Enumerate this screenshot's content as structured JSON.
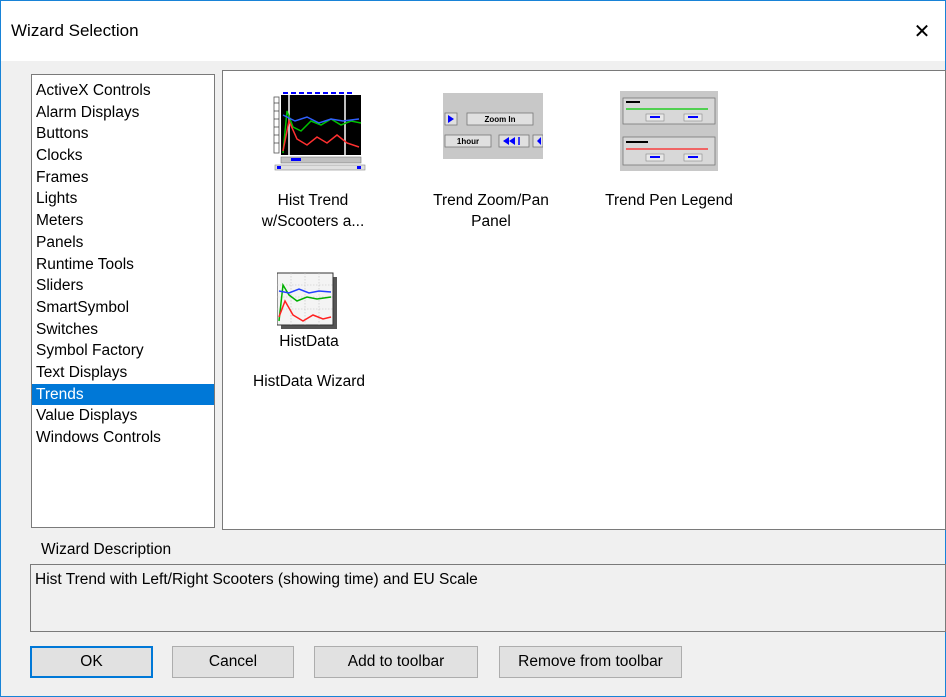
{
  "window": {
    "title": "Wizard Selection",
    "close_glyph": "✕",
    "accent": "#0078d7"
  },
  "categories": [
    {
      "label": "ActiveX Controls",
      "selected": false
    },
    {
      "label": "Alarm Displays",
      "selected": false
    },
    {
      "label": "Buttons",
      "selected": false
    },
    {
      "label": "Clocks",
      "selected": false
    },
    {
      "label": "Frames",
      "selected": false
    },
    {
      "label": "Lights",
      "selected": false
    },
    {
      "label": "Meters",
      "selected": false
    },
    {
      "label": "Panels",
      "selected": false
    },
    {
      "label": "Runtime Tools",
      "selected": false
    },
    {
      "label": "Sliders",
      "selected": false
    },
    {
      "label": "SmartSymbol",
      "selected": false
    },
    {
      "label": "Switches",
      "selected": false
    },
    {
      "label": "Symbol Factory",
      "selected": false
    },
    {
      "label": "Text Displays",
      "selected": false
    },
    {
      "label": "Trends",
      "selected": true
    },
    {
      "label": "Value Displays",
      "selected": false
    },
    {
      "label": "Windows Controls",
      "selected": false
    }
  ],
  "wizards": [
    {
      "caption_line1": "Hist Trend",
      "caption_line2": "w/Scooters a...",
      "icon": "hist-trend-icon"
    },
    {
      "caption_line1": "Trend Zoom/Pan",
      "caption_line2": "Panel",
      "icon": "trend-zoom-pan-icon",
      "icon_text": {
        "zoom_in": "Zoom In",
        "hour": "1hour"
      }
    },
    {
      "caption_line1": "Trend Pen Legend",
      "caption_line2": "",
      "icon": "trend-pen-legend-icon"
    },
    {
      "caption_line1": "HistData",
      "caption_line2": "HistData Wizard",
      "icon": "histdata-icon"
    }
  ],
  "description": {
    "label": "Wizard Description",
    "text": "Hist Trend with Left/Right Scooters (showing time) and EU Scale"
  },
  "buttons": {
    "ok": "OK",
    "cancel": "Cancel",
    "add_toolbar": "Add to toolbar",
    "remove_toolbar": "Remove from  toolbar"
  }
}
